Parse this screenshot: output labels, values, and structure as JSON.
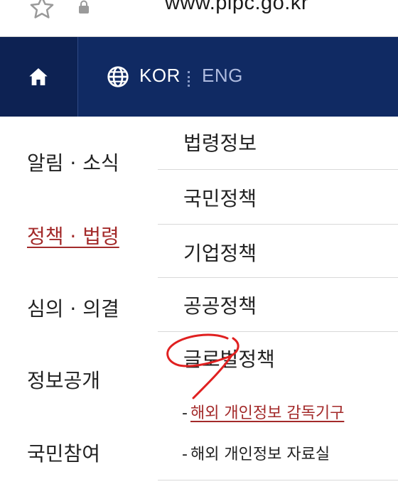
{
  "browser": {
    "url": "www.pipc.go.kr",
    "bookmark_icon": "star-outline-icon",
    "security_icon": "lock-icon"
  },
  "header": {
    "home_icon": "home-icon",
    "language_icon": "globe-icon",
    "languages": [
      "KOR",
      "ENG"
    ],
    "selected_language": "KOR",
    "background_color": "#102a63"
  },
  "main_menu": {
    "items": [
      "알림 · 소식",
      "정책 · 법령",
      "심의 · 의결",
      "정보공개",
      "국민참여"
    ],
    "active_index": 1,
    "active_color": "#a32a2a"
  },
  "sub_menu": {
    "items": [
      "법령정보",
      "국민정책",
      "기업정책",
      "공공정책",
      "글로벌정책"
    ],
    "children": [
      {
        "label": "해외 개인정보 감독기구",
        "active": true
      },
      {
        "label": "해외 개인정보 자료실",
        "active": false
      }
    ],
    "dash": "-"
  },
  "annotation": {
    "color": "#e02020",
    "target": "글로벌정책"
  }
}
